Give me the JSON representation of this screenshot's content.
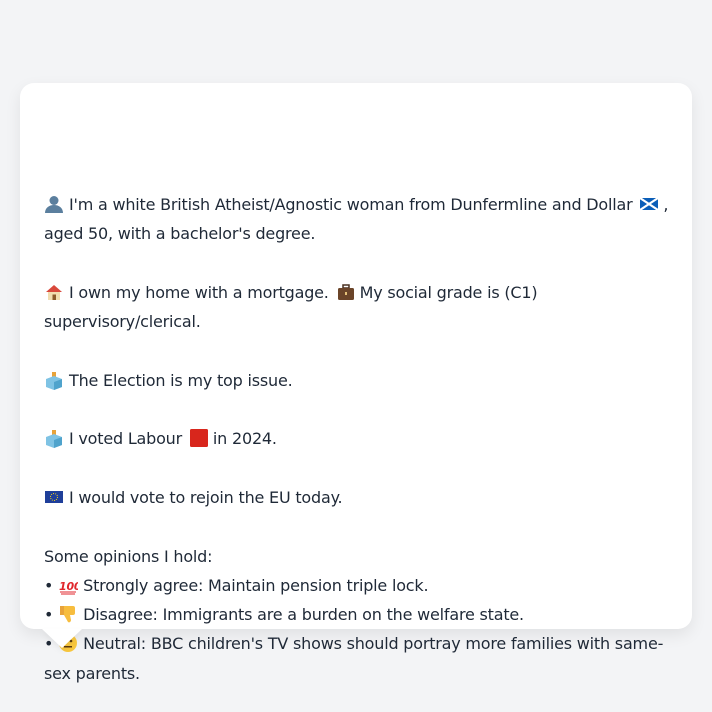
{
  "persona": {
    "identity": "I'm a white British Atheist/Agnostic woman from Dunfermline and Dollar",
    "identity_tail": ", aged 50, with a bachelor's degree.",
    "home": "I own my home with a mortgage.",
    "grade": "My social grade is (C1) supervisory/clerical.",
    "top_issue": "The Election is my top issue.",
    "voted_pre": "I voted Labour",
    "voted_post": "in 2024.",
    "eu": "I would vote to rejoin the EU today."
  },
  "opinions": {
    "heading": "Some opinions I hold:",
    "items": [
      {
        "bullet": "•",
        "icon": "hundred-points-icon",
        "text": "Strongly agree: Maintain pension triple lock."
      },
      {
        "bullet": "•",
        "icon": "thumbs-down-icon",
        "text": "Disagree: Immigrants are a burden on the welfare state."
      },
      {
        "bullet": "•",
        "icon": "neutral-face-icon",
        "text": "Neutral: BBC children's TV shows should portray more families with same-sex parents."
      }
    ]
  },
  "colors": {
    "labour": "#d8261c",
    "background": "#f3f4f6",
    "card": "#ffffff"
  }
}
